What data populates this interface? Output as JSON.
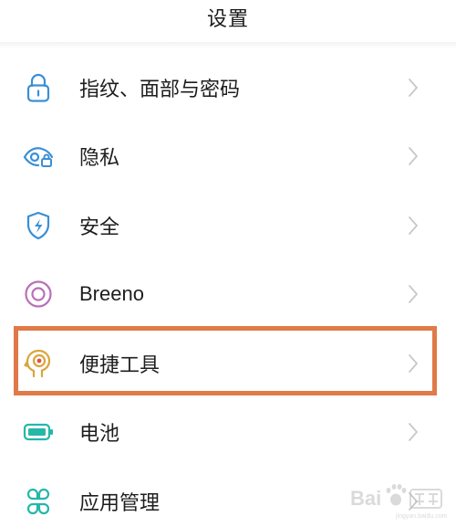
{
  "header": {
    "title": "设置"
  },
  "settings": {
    "items": [
      {
        "label": "指纹、面部与密码",
        "icon": "lock-icon",
        "color": "#3a8fd6"
      },
      {
        "label": "隐私",
        "icon": "privacy-eye-icon",
        "color": "#3a8fd6"
      },
      {
        "label": "安全",
        "icon": "security-shield-icon",
        "color": "#3a8fd6"
      },
      {
        "label": "Breeno",
        "icon": "breeno-icon",
        "color": "#b86fb8"
      },
      {
        "label": "便捷工具",
        "icon": "convenience-tools-icon",
        "color": "#d9a53a"
      },
      {
        "label": "电池",
        "icon": "battery-icon",
        "color": "#25b7a8"
      },
      {
        "label": "应用管理",
        "icon": "app-grid-icon",
        "color": "#25b7a8"
      }
    ]
  },
  "highlight": {
    "target": "便捷工具",
    "color": "#e07a48"
  },
  "watermark": {
    "logo": "Baidu 经验",
    "icon": "baidu-paw-icon"
  }
}
